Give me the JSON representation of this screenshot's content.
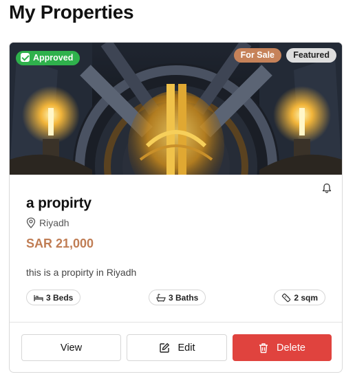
{
  "page": {
    "title": "My Properties"
  },
  "property": {
    "badges": {
      "approved": "Approved",
      "sale": "For Sale",
      "featured": "Featured"
    },
    "title": "a propirty",
    "location": "Riyadh",
    "price": "SAR 21,000",
    "description": "this is a propirty in Riyadh",
    "features": {
      "beds": "3 Beds",
      "baths": "3 Baths",
      "area": "2 sqm"
    },
    "actions": {
      "view": "View",
      "edit": "Edit",
      "delete": "Delete"
    }
  },
  "colors": {
    "approved": "#2fb14c",
    "sale": "#c68259",
    "featured": "#dedede",
    "price": "#c07d54",
    "delete": "#e0433e"
  },
  "icons": [
    "check-icon",
    "bell-icon",
    "map-pin-icon",
    "bed-icon",
    "bath-icon",
    "ruler-icon",
    "edit-icon",
    "trash-icon"
  ]
}
